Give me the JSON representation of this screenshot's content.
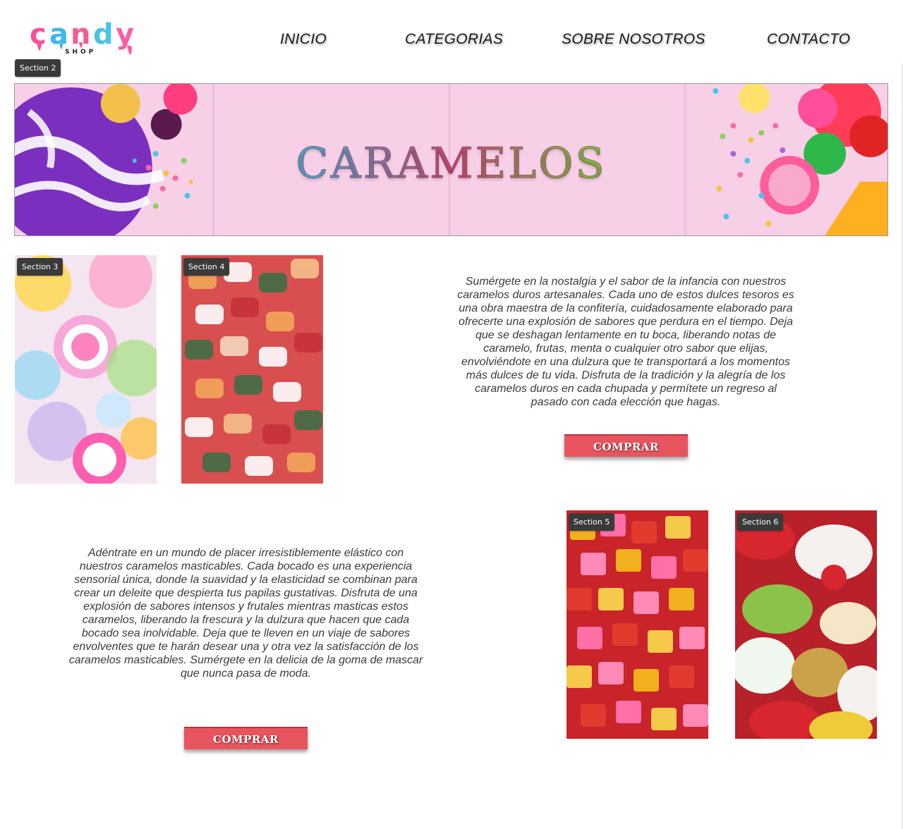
{
  "header": {
    "logo_text": "candy",
    "logo_subtext": "SHOP",
    "nav": [
      {
        "label": "INICIO"
      },
      {
        "label": "CATEGORIAS"
      },
      {
        "label": "SOBRE NOSOTROS"
      },
      {
        "label": "CONTACTO"
      }
    ]
  },
  "sections": {
    "s2": "Section 2",
    "s3": "Section 3",
    "s4": "Section 4",
    "s5": "Section 5",
    "s6": "Section 6"
  },
  "banner": {
    "title": "CARAMELOS"
  },
  "hard_candy": {
    "description": "Sumérgete en la nostalgia y el sabor de la infancia con nuestros caramelos duros artesanales. Cada uno de estos dulces tesoros es una obra maestra de la confitería, cuidadosamente elaborado para ofrecerte una explosión de sabores que perdura en el tiempo. Deja que se deshagan lentamente en tu boca, liberando notas de caramelo, frutas, menta o cualquier otro sabor que elijas, envolviéndote en una dulzura que te transportará a los momentos más dulces de tu vida. Disfruta de la tradición y la alegría de los caramelos duros en cada chupada y permítete un regreso al pasado con cada elección que hagas.",
    "button": "COMPRAR"
  },
  "chewy_candy": {
    "description": "Adéntrate en un mundo de placer irresistiblemente elástico con nuestros caramelos masticables. Cada bocado es una experiencia sensorial única, donde la suavidad y la elasticidad se combinan para crear un deleite que despierta tus papilas gustativas. Disfruta de una explosión de sabores intensos y frutales mientras masticas estos caramelos, liberando la frescura y la dulzura que hacen que cada bocado sea inolvidable. Deja que te lleven en un viaje de sabores envolventes que te harán desear una y otra vez la satisfacción de los caramelos masticables. Sumérgete en la delicia de la goma de mascar que nunca pasa de moda.",
    "button": "COMPRAR"
  },
  "colors": {
    "button": "#e8555f",
    "banner_bg": "#f9d6ec"
  }
}
